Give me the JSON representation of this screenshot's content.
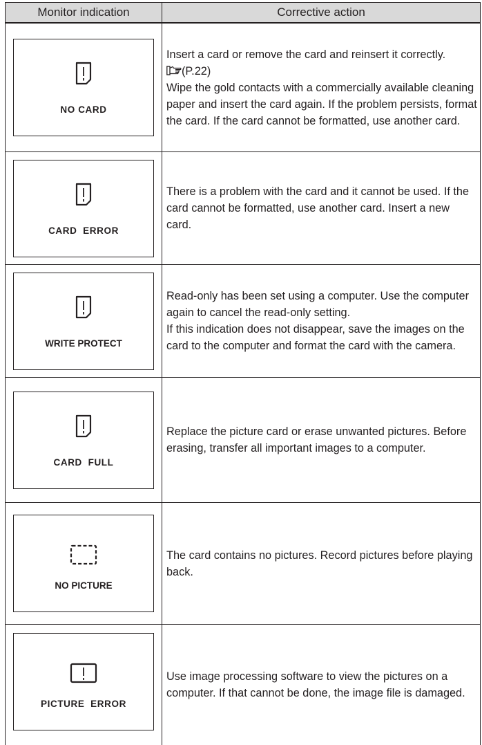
{
  "header": {
    "monitor_indication": "Monitor indication",
    "corrective_action": "Corrective action"
  },
  "rows": [
    {
      "indication": "NO CARD",
      "icon": "card-warning-icon",
      "action_lines": [
        "Insert a card or remove the card and reinsert it correctly.",
        "Wipe the gold contacts with a commercially available cleaning paper and insert the card again. If the problem persists, format the card. If the card cannot be formatted, use another card."
      ],
      "page_ref": "(P.22)",
      "page_ref_icon": "pointing-hand-icon"
    },
    {
      "indication": "CARD  ERROR",
      "icon": "card-warning-icon",
      "action_lines": [
        "There is a problem with the card and it cannot be used. If the card cannot be formatted, use another card. Insert a new card."
      ]
    },
    {
      "indication": "WRITE PROTECT",
      "icon": "card-warning-icon",
      "action_lines": [
        "Read-only has been set using a computer. Use the computer again to cancel the read-only setting.",
        "If this indication does not disappear, save the images on the card to the computer and format the card with the camera."
      ]
    },
    {
      "indication": "CARD  FULL",
      "icon": "card-warning-icon",
      "action_lines": [
        "Replace the picture card or erase unwanted pictures. Before erasing, transfer all important images to a computer."
      ]
    },
    {
      "indication": "NO PICTURE",
      "icon": "dashed-frame-icon",
      "action_lines": [
        "The card contains no pictures. Record pictures before playing back."
      ]
    },
    {
      "indication": "PICTURE  ERROR",
      "icon": "picture-warning-icon",
      "action_lines": [
        "Use image processing software to view the pictures on a computer. If that cannot be done, the image file is damaged."
      ]
    }
  ]
}
